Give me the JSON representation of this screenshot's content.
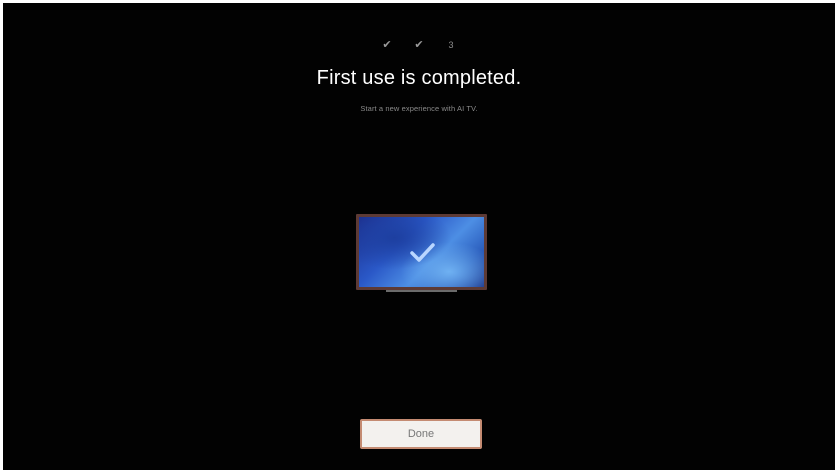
{
  "progress": {
    "steps": [
      {
        "icon": "check-icon",
        "glyph": "✔",
        "state": "completed"
      },
      {
        "icon": "check-icon",
        "glyph": "✔",
        "state": "completed"
      },
      {
        "icon": "step-number",
        "glyph": "3",
        "state": "current"
      }
    ]
  },
  "main": {
    "title": "First use is completed.",
    "subtitle": "Start a new experience with AI TV."
  },
  "illustration": {
    "icon": "tv-checkmark-icon",
    "colors": {
      "frame": "#5d3a35",
      "screen_dark": "#1c2f8d",
      "screen_light": "#6fb1f2"
    }
  },
  "actions": {
    "done_label": "Done",
    "border_color": "#c48b72"
  }
}
